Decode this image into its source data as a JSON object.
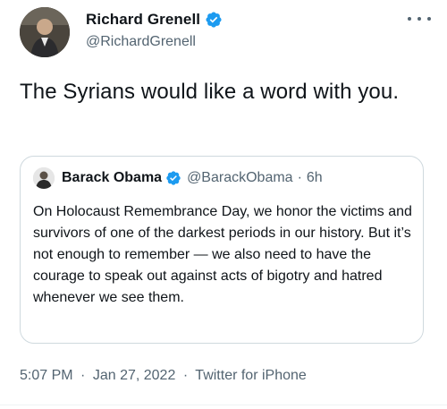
{
  "author": {
    "name": "Richard Grenell",
    "handle": "@RichardGrenell",
    "verified": true
  },
  "tweet": {
    "text": "The Syrians would like a word with you."
  },
  "quoted": {
    "name": "Barack Obama",
    "handle": "@BarackObama",
    "separator": "·",
    "time": "6h",
    "verified": true,
    "text": "On Holocaust Remembrance Day, we honor the victims and survivors of one of the darkest periods in our history. But it’s not enough to remember — we also need to have the courage to speak out against acts of bigotry and hatred whenever we see them."
  },
  "meta": {
    "time": "5:07 PM",
    "separator1": "·",
    "date": "Jan 27, 2022",
    "separator2": "·",
    "source": "Twitter for iPhone"
  },
  "colors": {
    "verified": "#1d9bf0",
    "secondary_text": "#536471",
    "border": "#cfd9de"
  },
  "icons": {
    "verified": "verified-badge-icon",
    "more": "more-icon"
  }
}
